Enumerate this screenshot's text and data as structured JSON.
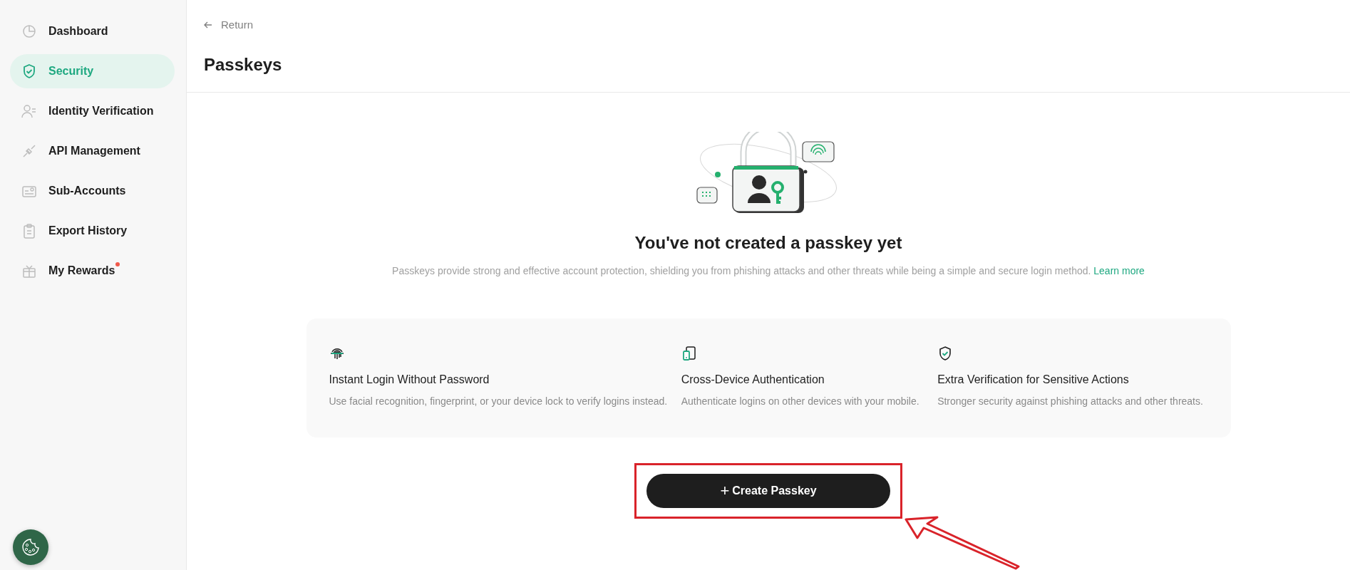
{
  "sidebar": {
    "items": [
      {
        "label": "Dashboard",
        "selected": false,
        "notification_dot": false
      },
      {
        "label": "Security",
        "selected": true,
        "notification_dot": false
      },
      {
        "label": "Identity Verification",
        "selected": false,
        "notification_dot": false
      },
      {
        "label": "API Management",
        "selected": false,
        "notification_dot": false
      },
      {
        "label": "Sub-Accounts",
        "selected": false,
        "notification_dot": false
      },
      {
        "label": "Export History",
        "selected": false,
        "notification_dot": false
      },
      {
        "label": "My Rewards",
        "selected": false,
        "notification_dot": true
      }
    ]
  },
  "header": {
    "back_link": "Return",
    "title": "Passkeys"
  },
  "empty_state": {
    "heading": "You've not created a passkey yet",
    "description": "Passkeys provide strong and effective account protection, shielding you from phishing attacks and other threats while being a simple and secure login method.",
    "learn_more": "Learn more"
  },
  "features": [
    {
      "title": "Instant Login Without Password",
      "description": "Use facial recognition, fingerprint, or your device lock to verify logins instead."
    },
    {
      "title": "Cross-Device Authentication",
      "description": "Authenticate logins on other devices with your mobile."
    },
    {
      "title": "Extra Verification for Sensitive Actions",
      "description": "Stronger security against phishing attacks and other threats."
    }
  ],
  "create_button": {
    "icon_text": "+",
    "label": "Create Passkey",
    "highlighted": true
  }
}
